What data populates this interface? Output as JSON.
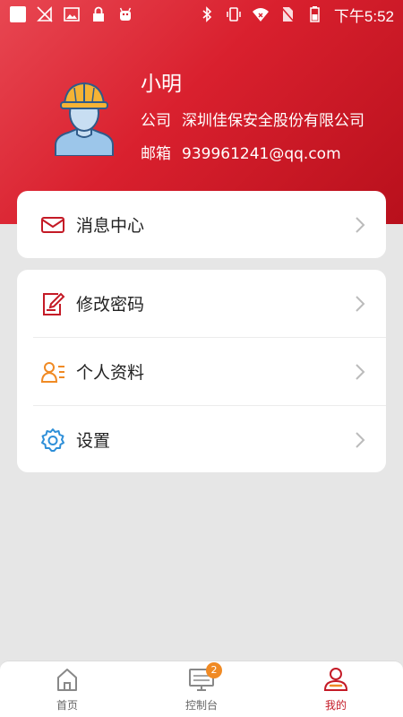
{
  "status_bar": {
    "time": "下午5:52",
    "left_icons": [
      "square-icon",
      "no-signal-icon",
      "image-icon",
      "lock-icon",
      "android-icon"
    ],
    "right_icons": [
      "bluetooth-icon",
      "vibrate-icon",
      "wifi-icon",
      "no-sim-icon",
      "battery-icon"
    ]
  },
  "profile": {
    "name": "小明",
    "company_label": "公司",
    "company_value": "深圳佳保安全股份有限公司",
    "email_label": "邮箱",
    "email_value": "939961241@qq.com",
    "avatar": "worker-helmet-avatar"
  },
  "menu": {
    "messages": {
      "label": "消息中心",
      "icon": "mail-icon"
    },
    "change_password": {
      "label": "修改密码",
      "icon": "edit-icon"
    },
    "profile_info": {
      "label": "个人资料",
      "icon": "user-card-icon"
    },
    "settings": {
      "label": "设置",
      "icon": "gear-icon"
    }
  },
  "tabs": [
    {
      "label": "首页",
      "icon": "home-icon",
      "active": false
    },
    {
      "label": "控制台",
      "icon": "console-icon",
      "active": false,
      "badge": "2"
    },
    {
      "label": "我的",
      "icon": "user-icon",
      "active": true
    }
  ],
  "colors": {
    "primary": "#d9202e",
    "accent_orange": "#f08a24",
    "icon_blue": "#2e8fd8",
    "background": "#e6e6e6"
  }
}
